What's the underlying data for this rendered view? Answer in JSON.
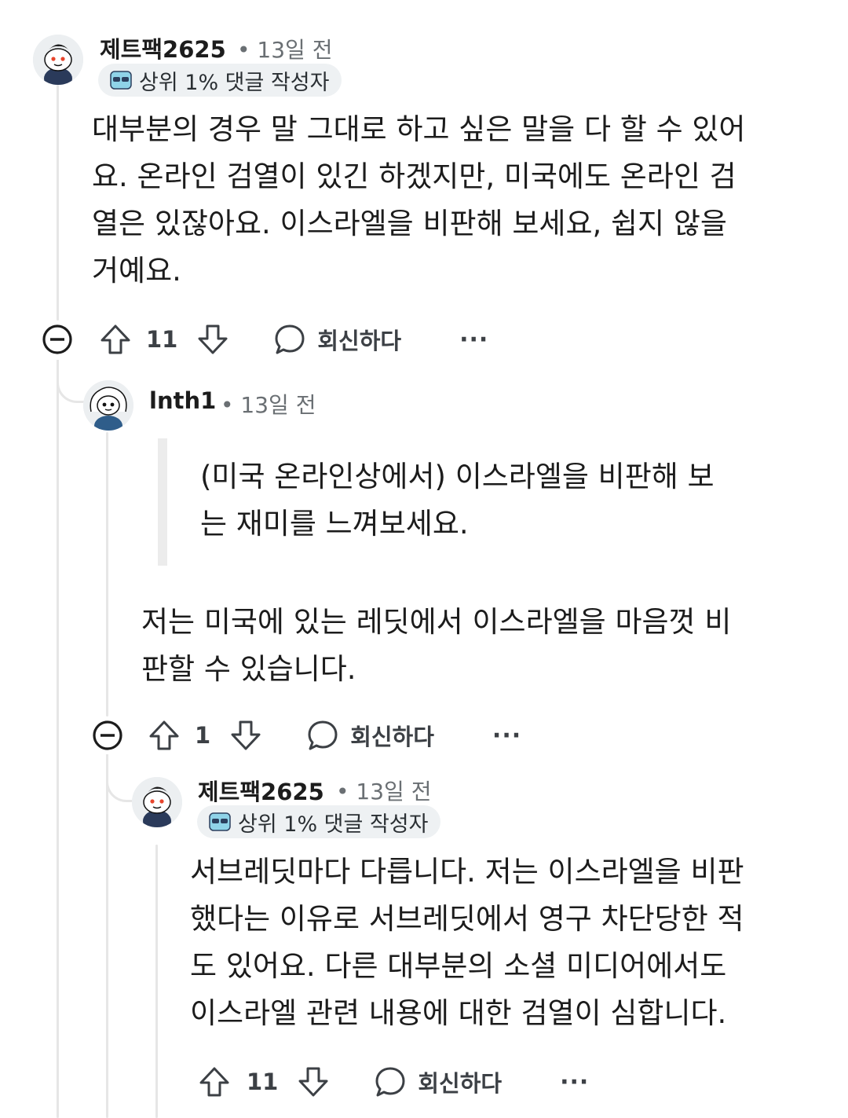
{
  "comments": [
    {
      "username": "제트팩2625",
      "time": "• 13일 전",
      "badge": "상위 1% 댓글 작성자",
      "lines": [
        "대부분의 경우 말 그대로 하고 싶은 말을 다 할 수 있어",
        "요. 온라인 검열이 있긴 하겠지만, 미국에도 온라인 검",
        "열은 있잖아요. 이스라엘을 비판해 보세요, 쉽지 않을",
        "거예요."
      ],
      "votes": "11",
      "reply_label": "회신하다",
      "more": "···"
    },
    {
      "username": "lnth1",
      "time": "• 13일 전",
      "quote_lines": [
        "(미국 온라인상에서) 이스라엘을 비판해 보",
        "는 재미를 느껴보세요."
      ],
      "lines": [
        "저는 미국에 있는 레딧에서 이스라엘을 마음껏 비",
        "판할 수 있습니다."
      ],
      "votes": "1",
      "reply_label": "회신하다",
      "more": "···"
    },
    {
      "username": "제트팩2625",
      "time": "• 13일 전",
      "badge": "상위 1% 댓글 작성자",
      "lines": [
        "서브레딧마다 다릅니다. 저는 이스라엘을 비판",
        "했다는 이유로 서브레딧에서 영구 차단당한 적",
        "도 있어요. 다른 대부분의 소셜 미디어에서도",
        "이스라엘 관련 내용에 대한 검열이 심합니다."
      ],
      "votes": "11",
      "reply_label": "회신하다",
      "more": "···"
    }
  ],
  "icons": {
    "collapse": "collapse-minus-icon",
    "upvote": "upvote-arrow-icon",
    "downvote": "downvote-arrow-icon",
    "reply": "speech-bubble-icon",
    "badge": "sunglasses-icon",
    "avatar": "snoo-avatar-icon"
  }
}
